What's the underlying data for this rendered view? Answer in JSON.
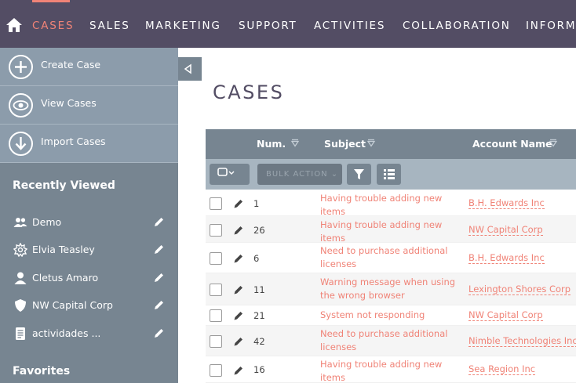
{
  "nav": {
    "items": [
      "CASES",
      "SALES",
      "MARKETING",
      "SUPPORT",
      "ACTIVITIES",
      "COLLABORATION",
      "INFORM"
    ],
    "active_color": "#f08377",
    "bg_color": "#534d64"
  },
  "sidebar": {
    "actions": [
      {
        "label": "Create Case",
        "icon": "plus-icon"
      },
      {
        "label": "View Cases",
        "icon": "eye-icon"
      },
      {
        "label": "Import Cases",
        "icon": "arrow-down-icon"
      }
    ],
    "recently_viewed_title": "Recently Viewed",
    "recently_viewed": [
      {
        "label": "Demo",
        "icon": "users-icon"
      },
      {
        "label": "Elvia Teasley",
        "icon": "gear-icon"
      },
      {
        "label": "Cletus Amaro",
        "icon": "person-icon"
      },
      {
        "label": "NW Capital Corp",
        "icon": "shield-icon"
      },
      {
        "label": "actividades ...",
        "icon": "document-icon"
      }
    ],
    "favorites_title": "Favorites"
  },
  "main": {
    "title": "CASES",
    "columns": [
      "Num.",
      "Subject",
      "Account Name"
    ],
    "bulk_action_label": "BULK ACTION",
    "rows": [
      {
        "num": "1",
        "subject": "Having trouble adding new items",
        "account": "B.H. Edwards Inc"
      },
      {
        "num": "26",
        "subject": "Having trouble adding new items",
        "account": "NW Capital Corp"
      },
      {
        "num": "6",
        "subject": "Need to purchase additional licenses",
        "account": "B.H. Edwards Inc"
      },
      {
        "num": "11",
        "subject": "Warning message when using the wrong browser",
        "account": "Lexington Shores Corp"
      },
      {
        "num": "21",
        "subject": "System not responding",
        "account": "NW Capital Corp"
      },
      {
        "num": "42",
        "subject": "Need to purchase additional licenses",
        "account": "Nimble Technologies Inc"
      },
      {
        "num": "16",
        "subject": "Having trouble adding new items",
        "account": "Sea Region Inc"
      }
    ]
  }
}
